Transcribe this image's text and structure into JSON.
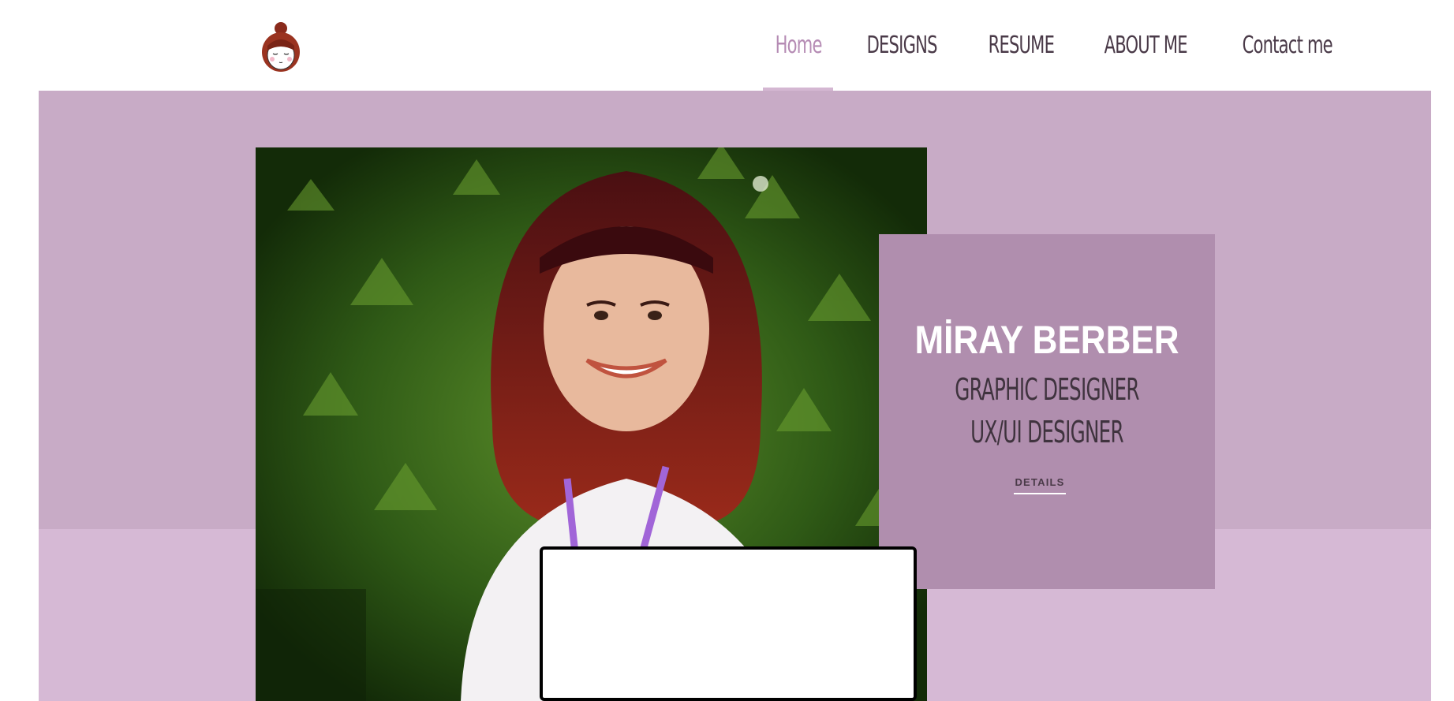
{
  "header": {
    "logo_icon": "girl-avatar-logo-icon",
    "nav": [
      {
        "label": "Home",
        "active": true
      },
      {
        "label": "DESIGNS",
        "active": false
      },
      {
        "label": "RESUME",
        "active": false
      },
      {
        "label": "ABOUT ME",
        "active": false
      },
      {
        "label": "Contact me",
        "active": false
      }
    ]
  },
  "hero": {
    "photo_icon": "portrait-photo",
    "card": {
      "name": "MİRAY BERBER",
      "roles": [
        "GRAPHIC DESIGNER",
        "UX/UI DESIGNER"
      ],
      "details_label": "DETAILS"
    }
  },
  "colors": {
    "accent": "#b58bb4",
    "hero_top": "#c8abc6",
    "hero_bottom": "#d6b9d5",
    "card": "#b08eae",
    "text_dark": "#4a3a48"
  }
}
